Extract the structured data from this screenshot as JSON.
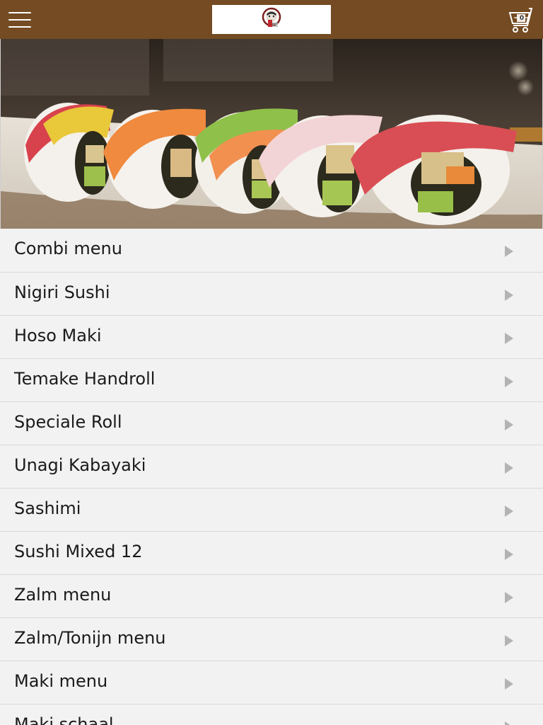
{
  "header": {
    "menu_icon": "hamburger-menu-icon",
    "logo_icon": "restaurant-logo-icon",
    "cart_icon": "shopping-cart-icon",
    "cart_count": "0",
    "bar_color": "#744b22"
  },
  "hero": {
    "image": "sushi-rolls-photo"
  },
  "menu": {
    "arrow_icon": "chevron-right-icon",
    "items": [
      {
        "label": "Combi menu"
      },
      {
        "label": "Nigiri Sushi"
      },
      {
        "label": "Hoso Maki"
      },
      {
        "label": "Temake Handroll"
      },
      {
        "label": "Speciale Roll"
      },
      {
        "label": "Unagi Kabayaki"
      },
      {
        "label": "Sashimi"
      },
      {
        "label": "Sushi Mixed 12"
      },
      {
        "label": "Zalm menu"
      },
      {
        "label": "Zalm/Tonijn menu"
      },
      {
        "label": "Maki menu"
      },
      {
        "label": "Maki schaal"
      }
    ]
  }
}
